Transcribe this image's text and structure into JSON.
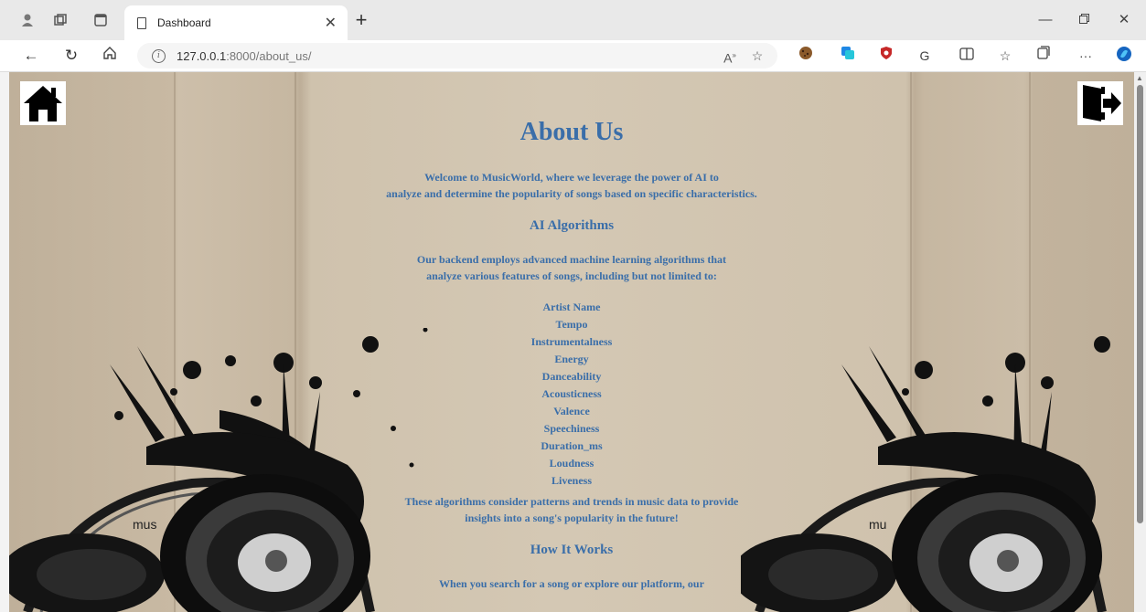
{
  "browser": {
    "tab_title": "Dashboard",
    "url_host": "127.0.0.1",
    "url_rest": ":8000/about_us/"
  },
  "page": {
    "title": "About Us",
    "intro": [
      "Welcome to MusicWorld, where we leverage the power of AI to",
      "analyze and determine the popularity of songs based on specific characteristics."
    ],
    "algorithms_heading": "AI Algorithms",
    "algorithms_text": [
      "Our backend employs advanced machine learning algorithms that",
      "analyze various features of songs, including but not limited to:"
    ],
    "features": [
      "Artist Name",
      "Tempo",
      "Instrumentalness",
      "Energy",
      "Danceability",
      "Acousticness",
      "Valence",
      "Speechiness",
      "Duration_ms",
      "Loudness",
      "Liveness"
    ],
    "patterns_text": [
      "These algorithms consider patterns and trends in music data to provide",
      "insights into a song's popularity in the future!"
    ],
    "how_heading": "How It Works",
    "how_text": "When you search for a song or explore our platform, our"
  },
  "colors": {
    "text": "#3a6ea9",
    "background": "#c9bba5"
  },
  "icons": {
    "home": "home-icon",
    "logout": "logout-icon"
  }
}
